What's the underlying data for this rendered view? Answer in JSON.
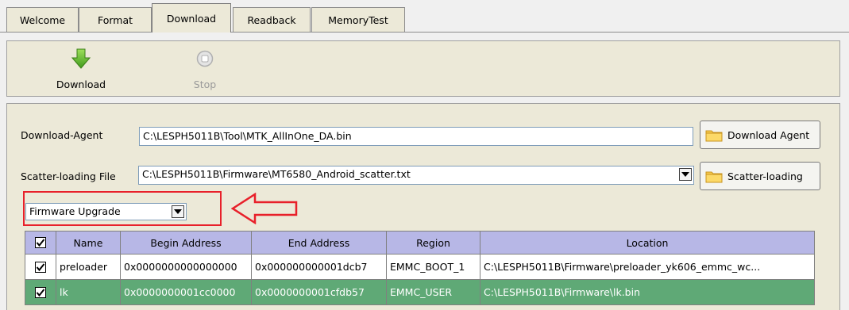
{
  "tabs": [
    {
      "label": "Welcome",
      "active": false
    },
    {
      "label": "Format",
      "active": false
    },
    {
      "label": "Download",
      "active": true
    },
    {
      "label": "Readback",
      "active": false
    },
    {
      "label": "MemoryTest",
      "active": false
    }
  ],
  "toolbar": {
    "download_label": "Download",
    "stop_label": "Stop"
  },
  "download_agent": {
    "label": "Download-Agent",
    "value": "C:\\LESPH5011B\\Tool\\MTK_AllInOne_DA.bin",
    "button_label": "Download Agent"
  },
  "scatter": {
    "label": "Scatter-loading File",
    "value": "C:\\LESPH5011B\\Firmware\\MT6580_Android_scatter.txt",
    "button_label": "Scatter-loading"
  },
  "mode": {
    "selected": "Firmware Upgrade"
  },
  "table": {
    "headers": [
      "",
      "Name",
      "Begin Address",
      "End Address",
      "Region",
      "Location"
    ],
    "rows": [
      {
        "checked": true,
        "name": "preloader",
        "begin": "0x0000000000000000",
        "end": "0x000000000001dcb7",
        "region": "EMMC_BOOT_1",
        "location": "C:\\LESPH5011B\\Firmware\\preloader_yk606_emmc_wc..."
      },
      {
        "checked": true,
        "name": "lk",
        "begin": "0x0000000001cc0000",
        "end": "0x0000000001cfdb57",
        "region": "EMMC_USER",
        "location": "C:\\LESPH5011B\\Firmware\\lk.bin"
      }
    ]
  },
  "icons": {
    "download": "down-arrow-icon",
    "stop": "stop-icon",
    "folder": "folder-icon",
    "annotation": "left-arrow-icon"
  },
  "colors": {
    "header_bg": "#b7b7e6",
    "selected_row_bg": "#5fa976",
    "annotation": "#e8202a",
    "download_arrow": "#6ab82c"
  }
}
